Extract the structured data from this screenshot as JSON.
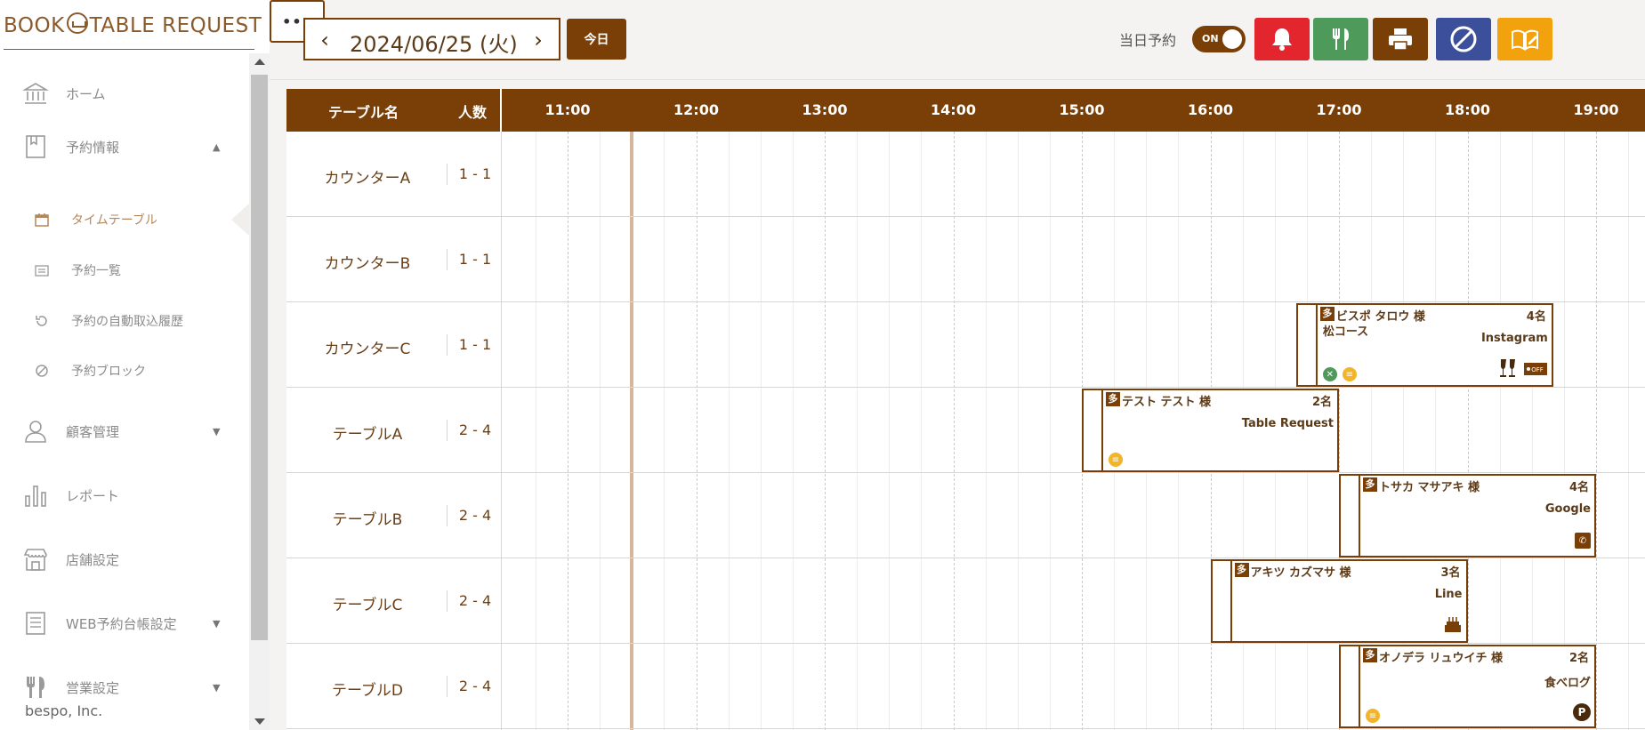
{
  "app": {
    "logo_left": "BOOK",
    "logo_right": "TABLE REQUEST",
    "company": "bespo, Inc."
  },
  "sidebar": {
    "items": [
      {
        "label": "ホーム",
        "icon": "bank-icon"
      },
      {
        "label": "予約情報",
        "icon": "book-icon",
        "arrow": "▲"
      },
      {
        "label": "顧客管理",
        "icon": "user-icon",
        "arrow": "▼"
      },
      {
        "label": "レポート",
        "icon": "bar-chart-icon"
      },
      {
        "label": "店舗設定",
        "icon": "store-icon"
      },
      {
        "label": "WEB予約台帳設定",
        "icon": "ledger-icon",
        "arrow": "▼"
      },
      {
        "label": "営業設定",
        "icon": "cutlery-icon",
        "arrow": "▼"
      }
    ],
    "sub_items": [
      {
        "label": "タイムテーブル",
        "icon": "calendar-icon",
        "active": true
      },
      {
        "label": "予約一覧",
        "icon": "list-icon"
      },
      {
        "label": "予約の自動取込履歴",
        "icon": "history-icon"
      },
      {
        "label": "予約ブロック",
        "icon": "block-icon"
      }
    ]
  },
  "header": {
    "date": "2024/06/25 (火)",
    "prev": "‹",
    "next": "›",
    "today_label": "今日",
    "same_day_label": "当日予約",
    "toggle_label": "ON",
    "more_label": "•••",
    "colors": {
      "alert": "#e3262e",
      "cutlery": "#4e9a5a",
      "print": "#7a3f06",
      "block": "#3b4f9a",
      "book": "#f2a20c"
    }
  },
  "timetable": {
    "col_table_name": "テーブル名",
    "col_capacity": "人数",
    "hours": [
      "11:00",
      "12:00",
      "13:00",
      "14:00",
      "15:00",
      "16:00",
      "17:00",
      "18:00",
      "19:00"
    ],
    "rows": [
      {
        "name": "カウンターA",
        "capacity": "1 - 1"
      },
      {
        "name": "カウンターB",
        "capacity": "1 - 1"
      },
      {
        "name": "カウンターC",
        "capacity": "1 - 1"
      },
      {
        "name": "テーブルA",
        "capacity": "2 - 4"
      },
      {
        "name": "テーブルB",
        "capacity": "2 - 4"
      },
      {
        "name": "テーブルC",
        "capacity": "2 - 4"
      },
      {
        "name": "テーブルD",
        "capacity": "2 - 4"
      }
    ],
    "reservations": [
      {
        "row": 2,
        "start": "16:40",
        "end": "18:40",
        "badge": "多",
        "guest": "ビスポ タロウ 様",
        "party": "4名",
        "course": "松コース",
        "source": "Instagram",
        "icons": [
          "food",
          "memo",
          "champagne",
          "coupon"
        ]
      },
      {
        "row": 3,
        "start": "15:00",
        "end": "17:00",
        "badge": "多",
        "guest": "テスト テスト 様",
        "party": "2名",
        "course": "",
        "source": "Table Request",
        "icons": [
          "memo"
        ]
      },
      {
        "row": 4,
        "start": "17:00",
        "end": "19:00",
        "badge": "多",
        "guest": "トサカ マサアキ 様",
        "party": "4名",
        "course": "",
        "source": "Google",
        "icons": [
          "phone"
        ]
      },
      {
        "row": 5,
        "start": "16:00",
        "end": "18:00",
        "badge": "多",
        "guest": "アキツ カズマサ 様",
        "party": "3名",
        "course": "",
        "source": "Line",
        "icons": [
          "cake"
        ]
      },
      {
        "row": 6,
        "start": "17:00",
        "end": "19:00",
        "badge": "多",
        "guest": "オノデラ リュウイチ 様",
        "party": "2名",
        "course": "",
        "source": "食べログ",
        "icons": [
          "memo",
          "parking"
        ]
      }
    ]
  }
}
